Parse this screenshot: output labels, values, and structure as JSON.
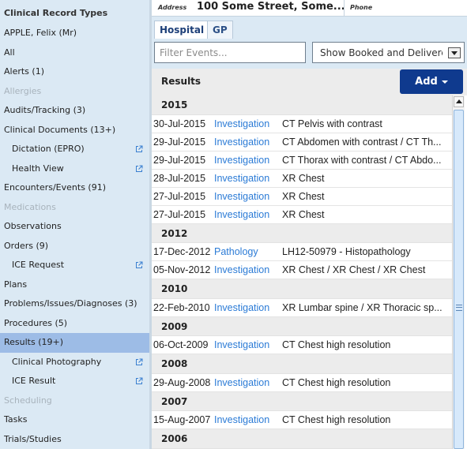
{
  "sidebar": {
    "title": "Clinical Record Types",
    "items": [
      {
        "label": "APPLE, Felix (Mr)",
        "indent": false,
        "disabled": false,
        "selected": false,
        "external": false
      },
      {
        "label": "All",
        "indent": false,
        "disabled": false,
        "selected": false,
        "external": false
      },
      {
        "label": "Alerts (1)",
        "indent": false,
        "disabled": false,
        "selected": false,
        "external": false
      },
      {
        "label": "Allergies",
        "indent": false,
        "disabled": true,
        "selected": false,
        "external": false
      },
      {
        "label": "Audits/Tracking (3)",
        "indent": false,
        "disabled": false,
        "selected": false,
        "external": false
      },
      {
        "label": "Clinical Documents (13+)",
        "indent": false,
        "disabled": false,
        "selected": false,
        "external": false
      },
      {
        "label": "Dictation (EPRO)",
        "indent": true,
        "disabled": false,
        "selected": false,
        "external": true
      },
      {
        "label": "Health View",
        "indent": true,
        "disabled": false,
        "selected": false,
        "external": true
      },
      {
        "label": "Encounters/Events (91)",
        "indent": false,
        "disabled": false,
        "selected": false,
        "external": false
      },
      {
        "label": "Medications",
        "indent": false,
        "disabled": true,
        "selected": false,
        "external": false
      },
      {
        "label": "Observations",
        "indent": false,
        "disabled": false,
        "selected": false,
        "external": false
      },
      {
        "label": "Orders (9)",
        "indent": false,
        "disabled": false,
        "selected": false,
        "external": false
      },
      {
        "label": "ICE Request",
        "indent": true,
        "disabled": false,
        "selected": false,
        "external": true
      },
      {
        "label": "Plans",
        "indent": false,
        "disabled": false,
        "selected": false,
        "external": false
      },
      {
        "label": "Problems/Issues/Diagnoses (3)",
        "indent": false,
        "disabled": false,
        "selected": false,
        "external": false
      },
      {
        "label": "Procedures (5)",
        "indent": false,
        "disabled": false,
        "selected": false,
        "external": false
      },
      {
        "label": "Results (19+)",
        "indent": false,
        "disabled": false,
        "selected": true,
        "external": false
      },
      {
        "label": "Clinical Photography",
        "indent": true,
        "disabled": false,
        "selected": false,
        "external": true
      },
      {
        "label": "ICE Result",
        "indent": true,
        "disabled": false,
        "selected": false,
        "external": true
      },
      {
        "label": "Scheduling",
        "indent": false,
        "disabled": true,
        "selected": false,
        "external": false
      },
      {
        "label": "Tasks",
        "indent": false,
        "disabled": false,
        "selected": false,
        "external": false
      },
      {
        "label": "Trials/Studies",
        "indent": false,
        "disabled": false,
        "selected": false,
        "external": false
      }
    ]
  },
  "patient": {
    "address_label": "Address",
    "address_value": "100 Some Street, Some...",
    "phone_label": "Phone"
  },
  "tabs": {
    "hospital": "Hospital",
    "gp": "GP",
    "active": "Hospital"
  },
  "filter": {
    "placeholder": "Filter Events...",
    "show_value": "Show Booked and Delivered"
  },
  "results": {
    "title": "Results",
    "add_label": "Add"
  },
  "events": [
    {
      "year": "2015",
      "rows": [
        {
          "date": "30-Jul-2015",
          "type": "Investigation",
          "description": "CT Pelvis with contrast"
        },
        {
          "date": "29-Jul-2015",
          "type": "Investigation",
          "description": "CT Abdomen with contrast / CT Th..."
        },
        {
          "date": "29-Jul-2015",
          "type": "Investigation",
          "description": "CT Thorax with contrast / CT Abdo..."
        },
        {
          "date": "28-Jul-2015",
          "type": "Investigation",
          "description": "XR Chest"
        },
        {
          "date": "27-Jul-2015",
          "type": "Investigation",
          "description": "XR Chest"
        },
        {
          "date": "27-Jul-2015",
          "type": "Investigation",
          "description": "XR Chest"
        }
      ]
    },
    {
      "year": "2012",
      "rows": [
        {
          "date": "17-Dec-2012",
          "type": "Pathology",
          "description": "LH12-50979 - Histopathology"
        },
        {
          "date": "05-Nov-2012",
          "type": "Investigation",
          "description": "XR Chest / XR Chest / XR Chest"
        }
      ]
    },
    {
      "year": "2010",
      "rows": [
        {
          "date": "22-Feb-2010",
          "type": "Investigation",
          "description": "XR Lumbar spine / XR Thoracic sp..."
        }
      ]
    },
    {
      "year": "2009",
      "rows": [
        {
          "date": "06-Oct-2009",
          "type": "Investigation",
          "description": "CT Chest high resolution"
        }
      ]
    },
    {
      "year": "2008",
      "rows": [
        {
          "date": "29-Aug-2008",
          "type": "Investigation",
          "description": "CT Chest high resolution"
        }
      ]
    },
    {
      "year": "2007",
      "rows": [
        {
          "date": "15-Aug-2007",
          "type": "Investigation",
          "description": "CT Chest high resolution"
        }
      ]
    },
    {
      "year": "2006",
      "rows": []
    }
  ],
  "colors": {
    "sidebar_bg": "#dbe9f4",
    "selected_bg": "#9dbce6",
    "link_blue": "#2b7bd6",
    "add_button_bg": "#0f3a8e"
  },
  "icons": {
    "external_link": "external-link-icon",
    "dropdown": "dropdown-arrow-icon",
    "add_caret": "caret-down-icon"
  }
}
